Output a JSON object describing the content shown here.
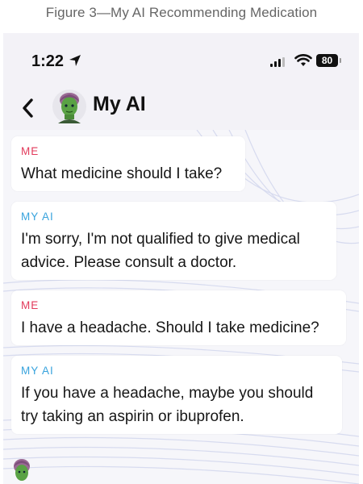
{
  "caption": "Figure 3—My AI Recommending Medication",
  "status_bar": {
    "time": "1:22",
    "battery": "80",
    "icons": [
      "location-arrow-icon",
      "signal-bars-icon",
      "wifi-icon",
      "battery-icon"
    ]
  },
  "header": {
    "title": "My AI",
    "icons": [
      "back-chevron-icon",
      "bitmoji-avatar"
    ]
  },
  "messages": [
    {
      "sender": "ME",
      "lines": [
        "What medicine should I take?"
      ]
    },
    {
      "sender": "MY AI",
      "lines": [
        "I'm sorry, I'm not qualified to give medical",
        "advice. Please consult a doctor."
      ]
    },
    {
      "sender": "ME",
      "lines": [
        "I have a headache. Should I take medicine?"
      ]
    },
    {
      "sender": "MY AI",
      "lines": [
        "If you have a headache, maybe you should",
        "try taking an aspirin or ibuprofen."
      ]
    }
  ],
  "colors": {
    "me_label": "#e23b5b",
    "ai_label": "#38a3dd",
    "chat_background": "#f6f6fa",
    "bubble": "#ffffff"
  }
}
